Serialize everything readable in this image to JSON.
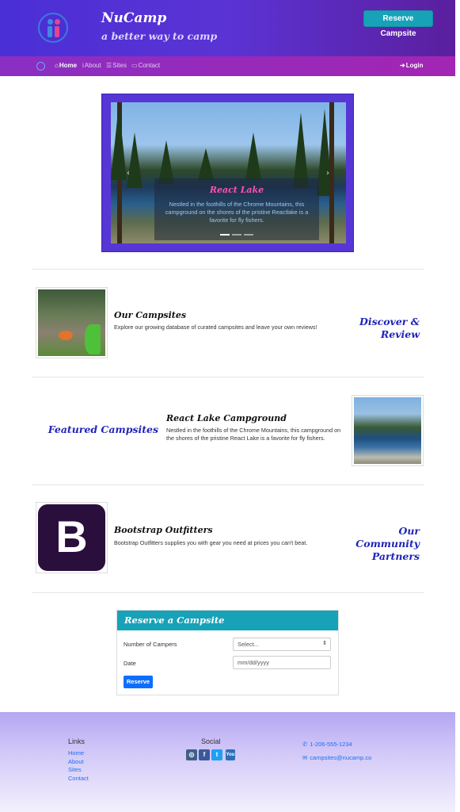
{
  "header": {
    "brand": "NuCamp",
    "tagline": "a better way to camp",
    "reserve_button": "Reserve Campsite"
  },
  "nav": {
    "items": [
      {
        "label": "Home",
        "icon": "home-icon",
        "active": true
      },
      {
        "label": "About",
        "icon": "info-icon",
        "active": false
      },
      {
        "label": "Sites",
        "icon": "list-icon",
        "active": false
      },
      {
        "label": "Contact",
        "icon": "address-card-icon",
        "active": false
      }
    ],
    "login": "Login"
  },
  "carousel": {
    "title": "React Lake",
    "text": "Nestled in the foothills of the Chrome Mountains, this campground on the shores of the pristine Reactlake is a favorite for fly fishers.",
    "slides": 3,
    "active_slide": 1
  },
  "rows": [
    {
      "title": "Our Campsites",
      "text": "Explore our growing database of curated campsites and leave your own reviews!",
      "side": "Discover & Review"
    },
    {
      "title": "React Lake Campground",
      "text": "Nestled in the foothills of the Chrome Mountains, this campground on the shores of the pristine React Lake is a favorite for fly fishers.",
      "side": "Featured Campsites"
    },
    {
      "title": "Bootstrap Outfitters",
      "text": "Bootstrap Outfitters supplies you with gear you need at prices you can't beat.",
      "side_line1": "Our Community",
      "side_line2": "Partners",
      "logo_letter": "B"
    }
  ],
  "form": {
    "heading": "Reserve a Campsite",
    "campers_label": "Number of Campers",
    "campers_value": "Select...",
    "date_label": "Date",
    "date_placeholder": "mm/dd/yyyy",
    "submit": "Reserve"
  },
  "footer": {
    "links_heading": "Links",
    "links": [
      "Home",
      "About",
      "Sites",
      "Contact"
    ],
    "social_heading": "Social",
    "social": [
      {
        "icon": "instagram-icon",
        "glyph": "◎",
        "color": "#3f5f8a"
      },
      {
        "icon": "facebook-icon",
        "glyph": "f",
        "color": "#3b5998"
      },
      {
        "icon": "twitter-icon",
        "glyph": "t",
        "color": "#1da1f2"
      },
      {
        "icon": "youtube-icon",
        "glyph": "You",
        "color": "#2d6fb7"
      }
    ],
    "phone": "1-206-555-1234",
    "email": "campsites@nucamp.co"
  },
  "colors": {
    "accent": "#17a2b8",
    "primary": "#5736d6",
    "headline_blue": "#1f24b8"
  }
}
